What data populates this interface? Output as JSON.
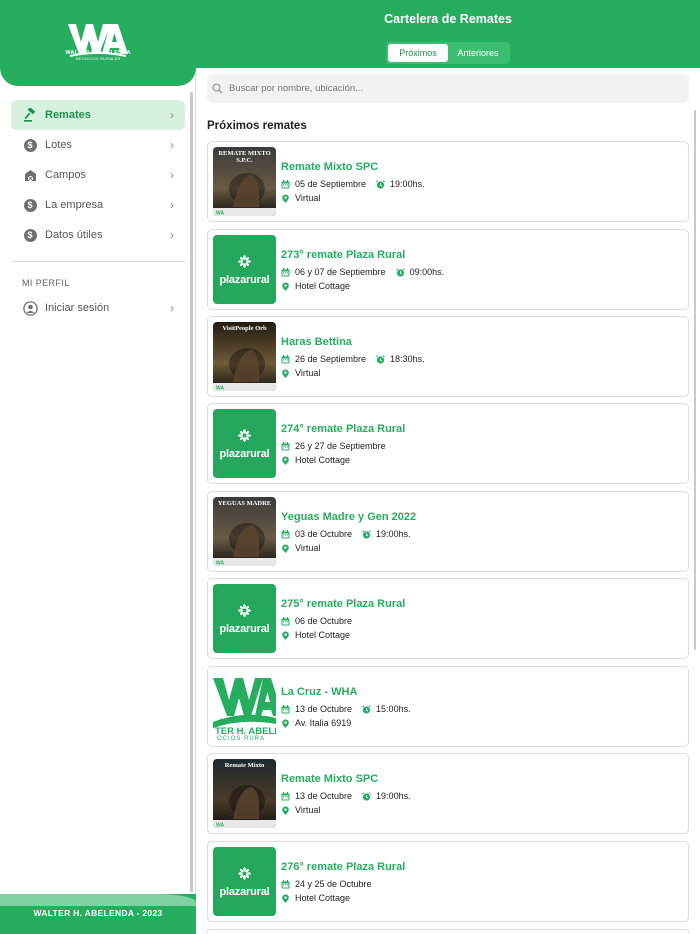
{
  "sidebar": {
    "logo_text": "WHA",
    "logo_sub": "WALTER H. ABELENDA",
    "logo_sub2": "NEGOCIOS RURALES",
    "items": [
      {
        "label": "Remates",
        "icon": "gavel-icon",
        "active": true
      },
      {
        "label": "Lotes",
        "icon": "dollar-coin-icon",
        "active": false
      },
      {
        "label": "Campos",
        "icon": "barn-icon",
        "active": false
      },
      {
        "label": "La empresa",
        "icon": "dollar-coin-icon",
        "active": false
      },
      {
        "label": "Datos útiles",
        "icon": "dollar-coin-icon",
        "active": false
      }
    ],
    "profile_section": "MI PERFIL",
    "login_label": "Iniciar sesión",
    "footer": "WALTER H. ABELENDA - 2023"
  },
  "header": {
    "title": "Cartelera de Remates",
    "tabs": [
      {
        "label": "Próximos",
        "active": true
      },
      {
        "label": "Anteriores",
        "active": false
      }
    ]
  },
  "search": {
    "placeholder": "Buscar por nombre, ubicación..."
  },
  "list": {
    "heading": "Próximos remates",
    "items": [
      {
        "title": "Remate Mixto SPC",
        "date": "05 de Septiembre",
        "time": "19:00hs.",
        "location": "Virtual",
        "thumb": "poster",
        "poster_text": "REMATE MIXTO S.P.C."
      },
      {
        "title": "273° remate Plaza Rural",
        "date": "06 y 07 de Septiembre",
        "time": "09:00hs.",
        "location": "Hotel Cottage",
        "thumb": "plazarural",
        "brand": "plazarural"
      },
      {
        "title": "Haras Bettina",
        "date": "26 de Septiembre",
        "time": "18:30hs.",
        "location": "Virtual",
        "thumb": "poster",
        "poster_text": "VisitPeople Orb"
      },
      {
        "title": "274° remate Plaza Rural",
        "date": "26 y 27 de Septiembre",
        "time": "",
        "location": "Hotel Cottage",
        "thumb": "plazarural",
        "brand": "plazarural"
      },
      {
        "title": "Yeguas Madre y Gen 2022",
        "date": "03 de Octubre",
        "time": "19:00hs.",
        "location": "Virtual",
        "thumb": "poster",
        "poster_text": "YEGUAS MADRE"
      },
      {
        "title": "275° remate Plaza Rural",
        "date": "06 de Octubre",
        "time": "",
        "location": "Hotel Cottage",
        "thumb": "plazarural",
        "brand": "plazarural"
      },
      {
        "title": "La Cruz - WHA",
        "date": "13 de Octubre",
        "time": "15:00hs.",
        "location": "Av. Italia 6919",
        "thumb": "wha",
        "brand": "WA"
      },
      {
        "title": "Remate Mixto SPC",
        "date": "13 de Octubre",
        "time": "19:00hs.",
        "location": "Virtual",
        "thumb": "poster",
        "poster_text": "Remate Mixto"
      },
      {
        "title": "276° remate Plaza Rural",
        "date": "24 y 25 de Octubre",
        "time": "",
        "location": "Hotel Cottage",
        "thumb": "plazarural",
        "brand": "plazarural"
      }
    ]
  },
  "colors": {
    "brand": "#27ad5f",
    "accent_light": "#d7f1e1"
  }
}
